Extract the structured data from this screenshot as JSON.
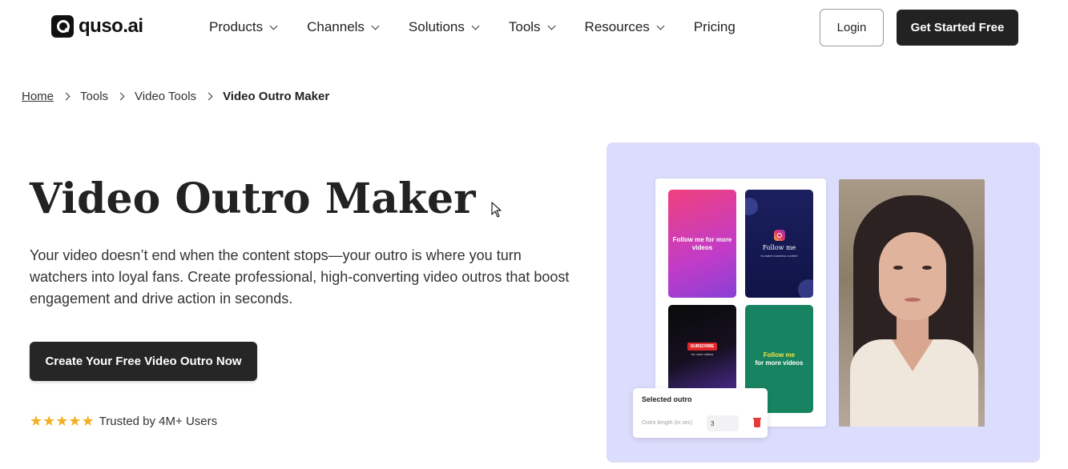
{
  "brand": {
    "logo_text": "quso.ai"
  },
  "nav": {
    "items": [
      {
        "label": "Products"
      },
      {
        "label": "Channels"
      },
      {
        "label": "Solutions"
      },
      {
        "label": "Tools"
      },
      {
        "label": "Resources"
      },
      {
        "label": "Pricing"
      }
    ],
    "login_label": "Login",
    "start_label": "Get Started Free"
  },
  "breadcrumb": {
    "items": [
      "Home",
      "Tools",
      "Video Tools",
      "Video Outro Maker"
    ]
  },
  "hero": {
    "title": "Video Outro Maker",
    "description": "Your video doesn’t end when the content stops—your outro is where you turn watchers into loyal fans. Create professional, high-converting video outros that boost engagement and drive action in seconds.",
    "cta_label": "Create Your Free Video Outro Now",
    "trust_text": "Trusted by 4M+ Users",
    "rating_stars": 5
  },
  "preview": {
    "tiles": [
      {
        "text": "Follow me for more videos"
      },
      {
        "text": "Follow me",
        "sub": "to watch business content"
      },
      {
        "badge": "SUBSCRIBE",
        "text": "for more videos"
      },
      {
        "highlight": "Follow me",
        "text": "for more videos"
      }
    ],
    "selected_card": {
      "title": "Selected outro",
      "length_label": "Outro length (in sec)",
      "length_value": "3"
    }
  },
  "colors": {
    "accent_dark": "#222222",
    "preview_bg": "#dcdcfc",
    "star": "#f2b01e"
  }
}
